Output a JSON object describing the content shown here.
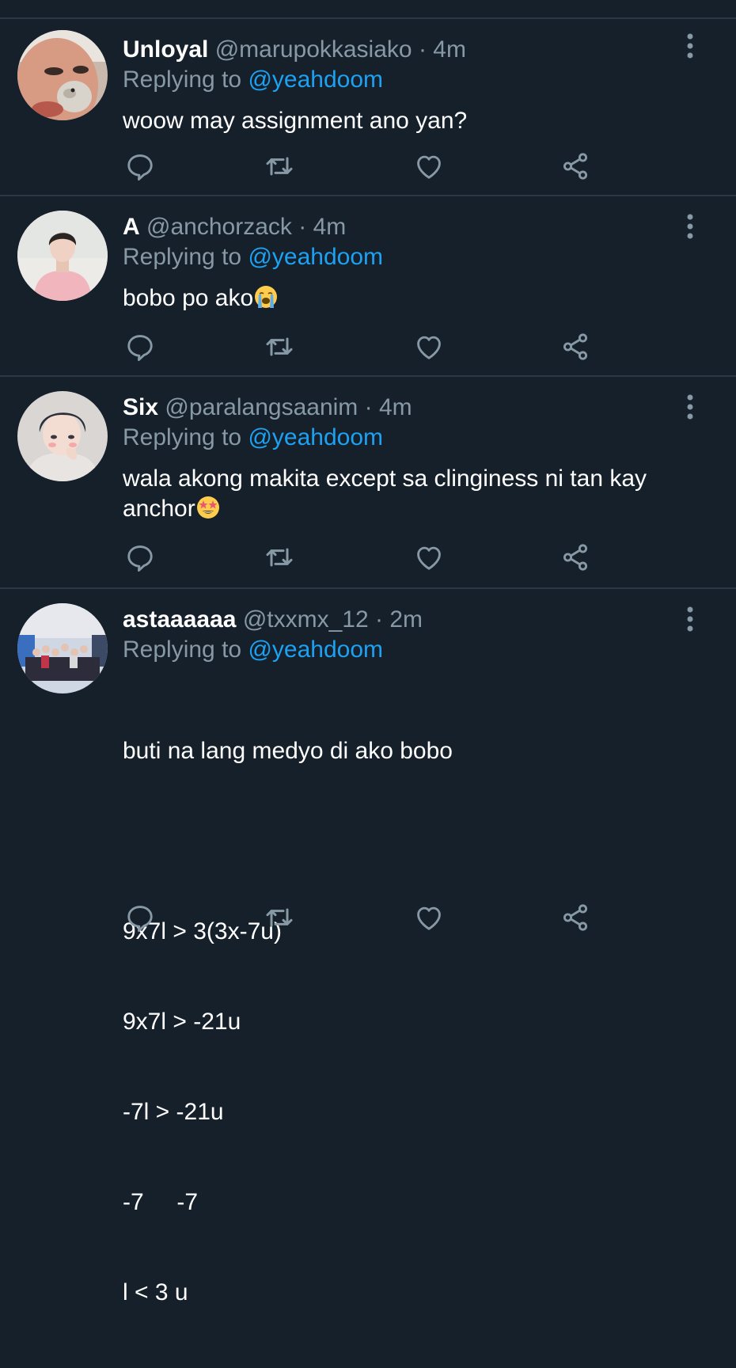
{
  "tweets": [
    {
      "display_name": "Unloyal",
      "handle": "@marupokkasiako",
      "separator": "·",
      "time": "4m",
      "replying_label": "Replying to",
      "replying_to": "@yeahdoom",
      "text_lines": [
        "woow may assignment ano yan?"
      ],
      "avatar_icon": "avatar-photo-woman-hamster",
      "emoji": null
    },
    {
      "display_name": "A",
      "handle": "@anchorzack",
      "separator": "·",
      "time": "4m",
      "replying_label": "Replying to",
      "replying_to": "@yeahdoom",
      "text_lines": [
        "bobo po ako"
      ],
      "avatar_icon": "avatar-photo-pink-sweater",
      "emoji": "loudly-crying-face-icon"
    },
    {
      "display_name": "Six",
      "handle": "@paralangsaanim",
      "separator": "·",
      "time": "4m",
      "replying_label": "Replying to",
      "replying_to": "@yeahdoom",
      "text_lines": [
        "wala akong makita except sa clinginess ni tan kay",
        "anchor"
      ],
      "avatar_icon": "avatar-illustration-boy",
      "emoji": "star-struck-face-icon"
    },
    {
      "display_name": "astaaaaaa",
      "handle": "@txxmx_12",
      "separator": "·",
      "time": "2m",
      "replying_label": "Replying to",
      "replying_to": "@yeahdoom",
      "text_lines": [
        "buti na lang medyo di ako bobo",
        "",
        "9x7l > 3(3x-7u)",
        "9x7l > -21u",
        "-7l > -21u",
        "-7     -7",
        "l < 3 u"
      ],
      "avatar_icon": "avatar-photo-group-stage",
      "emoji": null
    }
  ],
  "action_icons": [
    "reply-icon",
    "retweet-icon",
    "like-icon",
    "share-icon"
  ],
  "colors": {
    "background": "#15202b",
    "divider": "#2a3845",
    "secondary_text": "#8899a6",
    "link": "#1da1f2",
    "primary_text": "#ffffff"
  }
}
